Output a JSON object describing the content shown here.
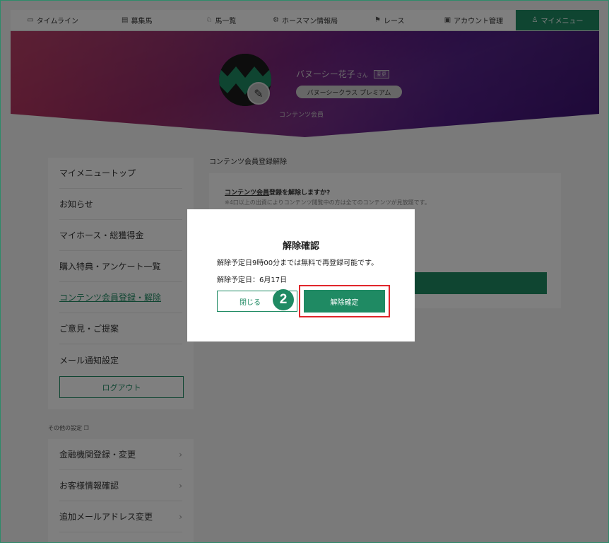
{
  "nav": {
    "items": [
      {
        "label": "タイムライン",
        "icon": "timeline-icon",
        "glyph": "▭"
      },
      {
        "label": "募集馬",
        "icon": "horse-list-icon",
        "glyph": "▤"
      },
      {
        "label": "馬一覧",
        "icon": "horse-icon",
        "glyph": "♘"
      },
      {
        "label": "ホースマン情報局",
        "icon": "info-icon",
        "glyph": "⚙"
      },
      {
        "label": "レース",
        "icon": "flag-icon",
        "glyph": "⚑"
      },
      {
        "label": "アカウント管理",
        "icon": "account-icon",
        "glyph": "▣"
      },
      {
        "label": "マイメニュー",
        "icon": "user-icon",
        "glyph": "♙",
        "active": true
      }
    ]
  },
  "profile": {
    "name": "バヌーシー花子",
    "honorific": "さん",
    "change_label": "変更",
    "class_label": "バヌーシークラス プレミアム",
    "membership": "コンテンツ会員"
  },
  "sidebar": {
    "items": [
      {
        "label": "マイメニュートップ"
      },
      {
        "label": "お知らせ"
      },
      {
        "label": "マイホース・総獲得金"
      },
      {
        "label": "購入特典・アンケート一覧"
      },
      {
        "label": "コンテンツ会員登録・解除",
        "current": true
      },
      {
        "label": "ご意見・ご提案"
      },
      {
        "label": "メール通知設定"
      }
    ],
    "logout_label": "ログアウト",
    "other_settings_label": "その他の設定",
    "other_items": [
      {
        "label": "金融機関登録・変更"
      },
      {
        "label": "お客様情報確認"
      },
      {
        "label": "追加メールアドレス変更"
      }
    ]
  },
  "main": {
    "title": "コンテンツ会員登録解除",
    "question_underlined": "コンテンツ会員",
    "question_rest": "登録を解除しますか?",
    "note": "※4口以上の出資によりコンテンツ閲覧中の方は全てのコンテンツが見放題です。"
  },
  "modal": {
    "title": "解除確認",
    "line1": "解除予定日9時00分までは無料で再登録可能です。",
    "line2": "解除予定日：6月17日",
    "close_label": "閉じる",
    "confirm_label": "解除確定",
    "step_number": "2"
  },
  "colors": {
    "brand_green": "#1f8a63",
    "highlight_red": "#e0262b"
  }
}
